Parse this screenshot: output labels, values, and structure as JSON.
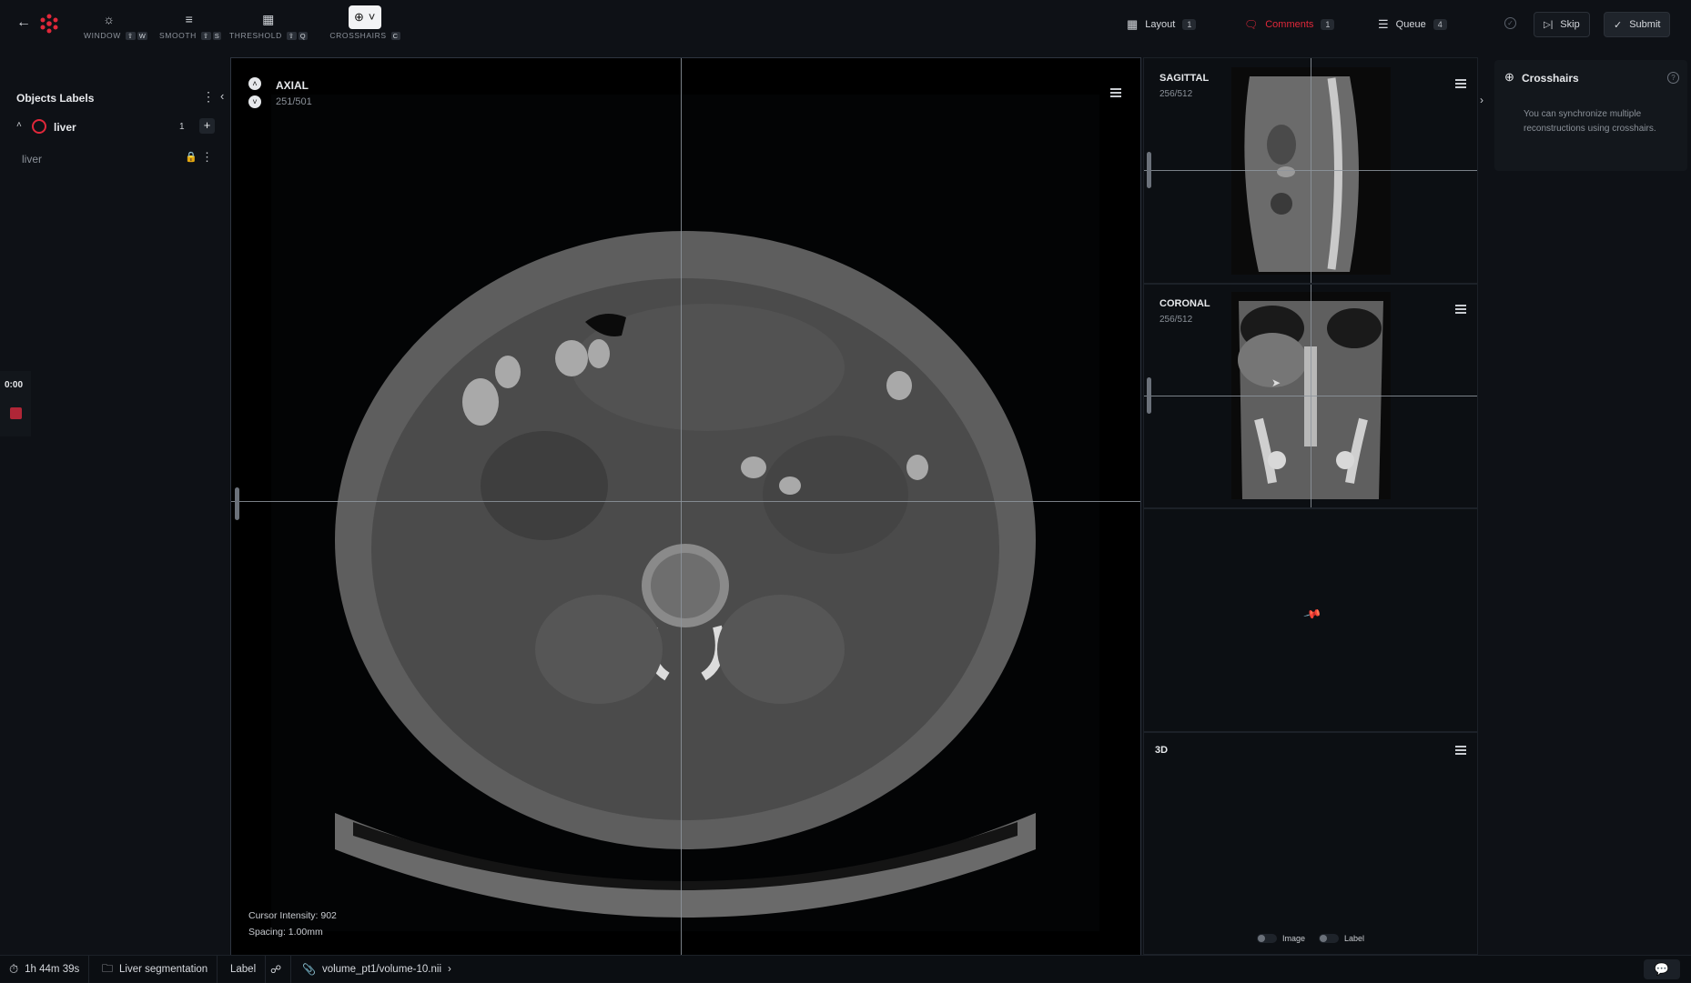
{
  "toolbar": {
    "tools": [
      {
        "label": "WINDOW",
        "key": "W",
        "icon": "sun-icon"
      },
      {
        "label": "SMOOTH",
        "key": "S",
        "icon": "smooth-icon"
      },
      {
        "label": "THRESHOLD",
        "key": "Q",
        "icon": "grid-icon"
      },
      {
        "label": "CROSSHAIRS",
        "key": "C",
        "icon": "crosshair-icon"
      }
    ],
    "layout_label": "Layout",
    "layout_count": "1",
    "comments_label": "Comments",
    "comments_count": "1",
    "queue_label": "Queue",
    "queue_count": "4",
    "skip_label": "Skip",
    "submit_label": "Submit"
  },
  "left_panel": {
    "title": "Objects Labels",
    "group": {
      "name": "liver",
      "count": "1"
    },
    "instance": {
      "name": "liver"
    },
    "timer": "0:00"
  },
  "viewports": {
    "axial": {
      "title": "AXIAL",
      "slice": "251/501",
      "cursor_intensity": "Cursor Intensity: 902",
      "spacing": "Spacing: 1.00mm"
    },
    "sagittal": {
      "title": "SAGITTAL",
      "slice": "256/512"
    },
    "coronal": {
      "title": "CORONAL",
      "slice": "256/512"
    },
    "three_d": {
      "title": "3D",
      "image_toggle": "Image",
      "label_toggle": "Label"
    }
  },
  "right_panel": {
    "title": "Crosshairs",
    "description": "You can synchronize multiple reconstructions using crosshairs."
  },
  "status_bar": {
    "time": "1h 44m 39s",
    "project": "Liver segmentation",
    "mode": "Label",
    "file": "volume_pt1/volume-10.nii"
  },
  "colors": {
    "accent_red": "#e0283a",
    "background": "#0e1116",
    "viewport_bg": "#000000"
  }
}
